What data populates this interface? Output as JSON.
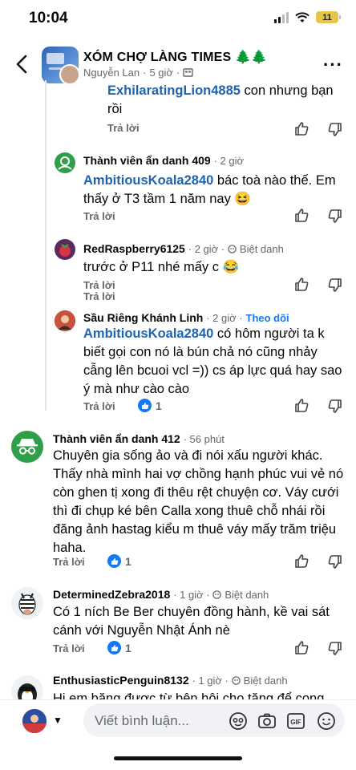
{
  "status_bar": {
    "time": "10:04",
    "battery": "11"
  },
  "header": {
    "title": "XÓM CHỢ LÀNG TIMES 🌲🌲",
    "subtitle_author": "Nguyễn Lan",
    "subtitle_sep": "·",
    "subtitle_time": "5 giờ",
    "subtitle_sep2": "·"
  },
  "comments": [
    {
      "id": "c0",
      "author": "",
      "body_mention": "ExhilaratingLion4885",
      "body": " con nhưng bạn rồi",
      "reply": "Trả lời"
    },
    {
      "id": "c1",
      "author": "Thành viên ẩn danh 409",
      "time": "· 2 giờ",
      "body_mention": "AmbitiousKoala2840",
      "body": " bác toà nào thế. Em thấy ở T3 tầm 1 năm nay 😆",
      "reply": "Trả lời"
    },
    {
      "id": "c2",
      "author": "RedRaspberry6125",
      "time": "· 2 giờ ·",
      "tag": "Biệt danh",
      "body": "trước ở P11 nhé mấy c 😂",
      "reply": "Trả lời"
    },
    {
      "id": "c3",
      "author": "Sầu Riêng Khánh Linh",
      "time": "· 2 giờ ·",
      "follow": "Theo dõi",
      "body_mention": "AmbitiousKoala2840",
      "body": " có hôm người ta k biết gọi con nó là bún chả nó cũng nhảy cẫng lên bcuoi vcl =)) cs áp lực quá hay sao ý mà như cào cào",
      "reply": "Trả lời",
      "likes": "1"
    },
    {
      "id": "c4",
      "author": "Thành viên ẩn danh 412",
      "time": "· 56 phút",
      "body": "Chuyên gia sống ảo và đi nói xấu người khác. Thấy nhà mình hai vợ chồng hạnh phúc vui vẻ nó còn ghen tị xong đi thêu rệt chuyện cơ. Váy cưới thì đi chụp ké bên Calla xong thuê chỗ nhái rồi đăng ảnh hastag kiểu m thuê váy mấy trăm triệu haha.",
      "reply": "Trả lời",
      "likes": "1"
    },
    {
      "id": "c5",
      "author": "DeterminedZebra2018",
      "time": "· 1 giờ ·",
      "tag": "Biệt danh",
      "body": "Có 1 ních Be Ber chuyên đồng hành, kề vai sát cánh với Nguyễn Nhật Ánh nè",
      "reply": "Trả lời",
      "likes": "1"
    },
    {
      "id": "c6",
      "author": "EnthusiasticPenguin8132",
      "time": "· 1 giờ ·",
      "tag": "Biệt danh",
      "body": "Hi em băng được từ bên hội cho tặng để cong"
    }
  ],
  "composer": {
    "placeholder": "Viết bình luận..."
  },
  "colors": {
    "accent": "#1877f2",
    "mention": "#1e63b0",
    "muted": "#65676b"
  }
}
